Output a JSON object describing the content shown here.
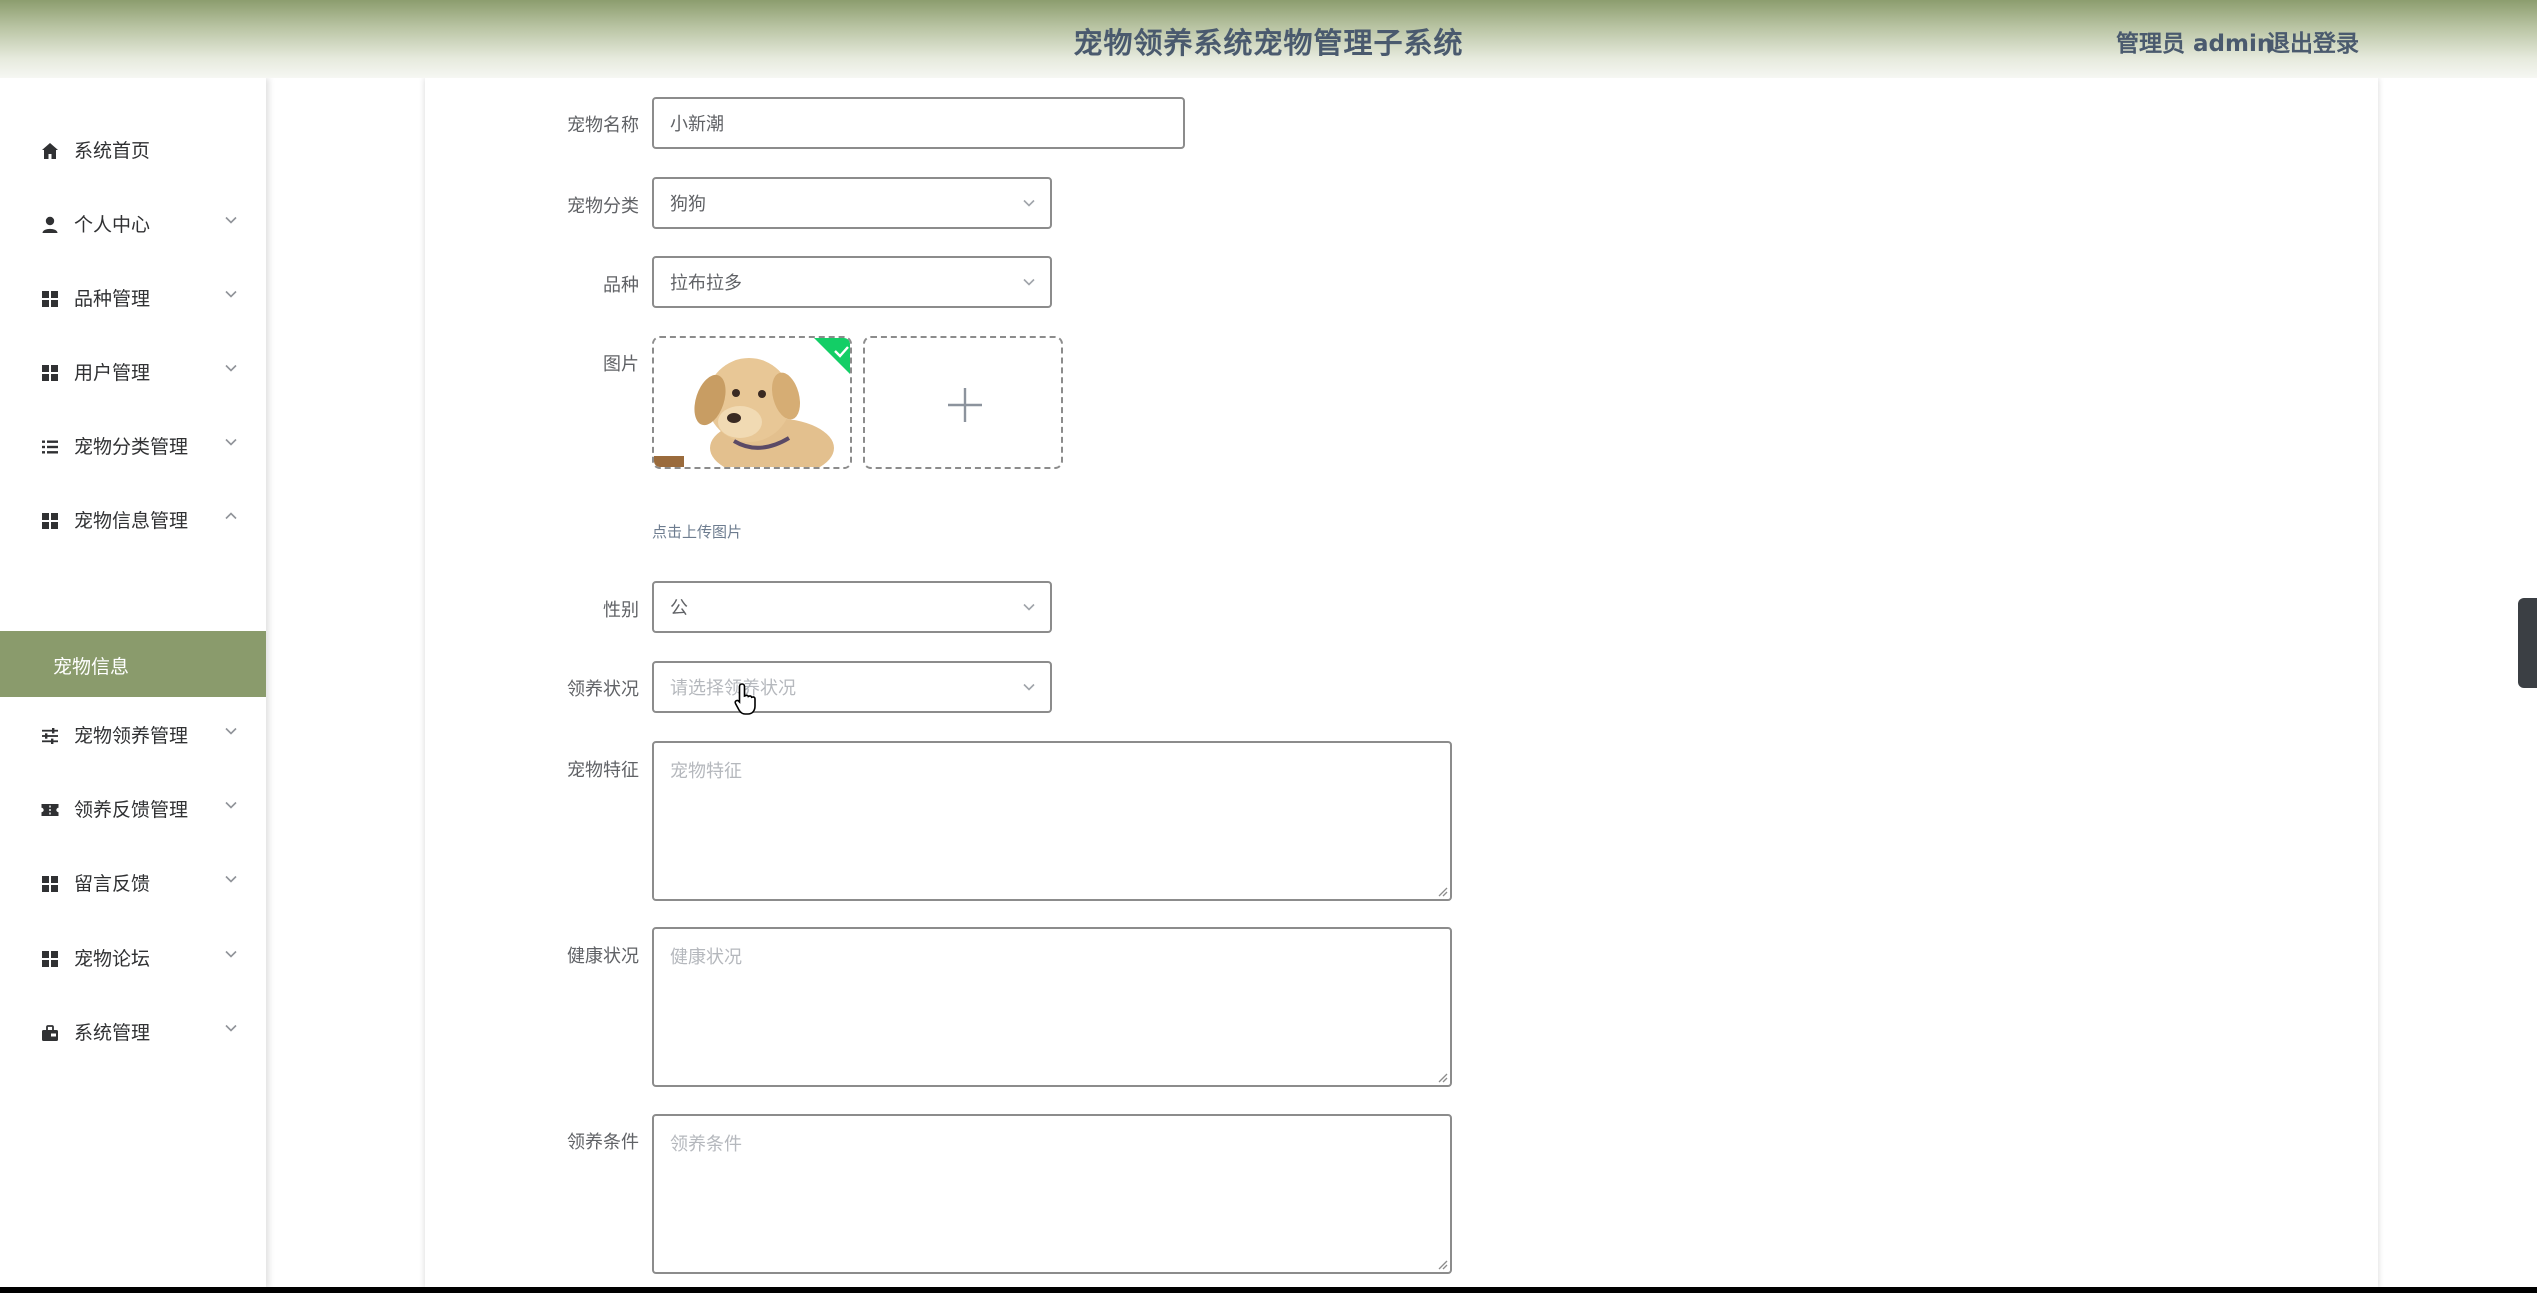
{
  "header": {
    "title": "宠物领养系统宠物管理子系统",
    "user_label": "管理员 admin",
    "logout_label": "退出登录"
  },
  "sidebar": {
    "items": [
      {
        "label": "系统首页",
        "icon": "home-icon"
      },
      {
        "label": "个人中心",
        "icon": "user-icon"
      },
      {
        "label": "品种管理",
        "icon": "grid-icon"
      },
      {
        "label": "用户管理",
        "icon": "grid-icon"
      },
      {
        "label": "宠物分类管理",
        "icon": "list-icon"
      },
      {
        "label": "宠物信息管理",
        "icon": "grid-icon"
      },
      {
        "label": "宠物领养管理",
        "icon": "sliders-icon"
      },
      {
        "label": "领养反馈管理",
        "icon": "ticket-icon"
      },
      {
        "label": "留言反馈",
        "icon": "grid-icon"
      },
      {
        "label": "宠物论坛",
        "icon": "grid-icon"
      },
      {
        "label": "系统管理",
        "icon": "briefcase-icon"
      }
    ],
    "active_sub_item": "宠物信息"
  },
  "form": {
    "name": {
      "label": "宠物名称",
      "value": "小新潮"
    },
    "category": {
      "label": "宠物分类",
      "value": "狗狗"
    },
    "breed": {
      "label": "品种",
      "value": "拉布拉多"
    },
    "image": {
      "label": "图片",
      "upload_hint": "点击上传图片"
    },
    "gender": {
      "label": "性别",
      "value": "公"
    },
    "adoption_status": {
      "label": "领养状况",
      "placeholder": "请选择领养状况"
    },
    "features": {
      "label": "宠物特征",
      "placeholder": "宠物特征"
    },
    "health": {
      "label": "健康状况",
      "placeholder": "健康状况"
    },
    "conditions": {
      "label": "领养条件",
      "placeholder": "领养条件"
    }
  },
  "colors": {
    "accent": "#8a9b6c",
    "success_badge": "#13ce66",
    "header_text": "#4a5a6e"
  }
}
